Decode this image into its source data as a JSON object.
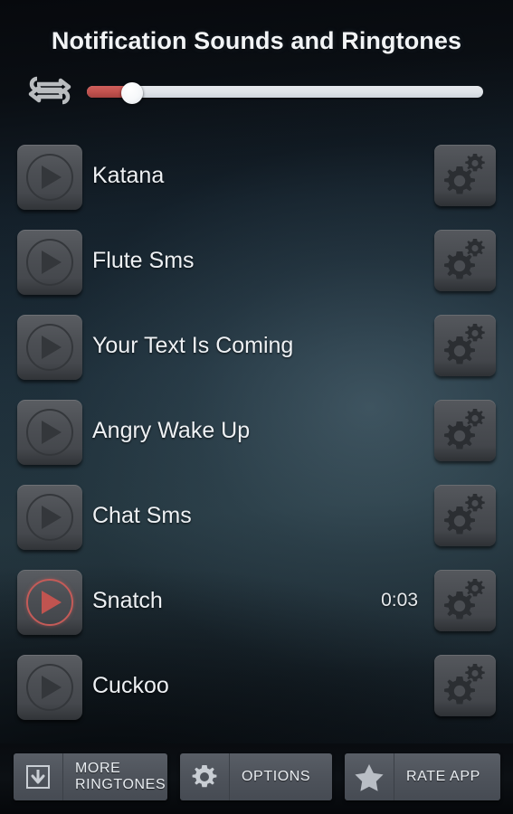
{
  "header": {
    "title": "Notification Sounds and Ringtones",
    "repeat_icon": "repeat-loop-icon",
    "slider": {
      "value_percent": 11,
      "fill_color": "#c0504d",
      "track_color": "#dfe3e8",
      "thumb_color": "#ffffff"
    }
  },
  "list": {
    "items": [
      {
        "name": "Katana",
        "play_icon": "play-icon",
        "gear_icon": "gears-icon",
        "duration": "",
        "playing": false
      },
      {
        "name": "Flute Sms",
        "play_icon": "play-icon",
        "gear_icon": "gears-icon",
        "duration": "",
        "playing": false
      },
      {
        "name": "Your Text Is Coming",
        "play_icon": "play-icon",
        "gear_icon": "gears-icon",
        "duration": "",
        "playing": false
      },
      {
        "name": "Angry Wake Up",
        "play_icon": "play-icon",
        "gear_icon": "gears-icon",
        "duration": "",
        "playing": false
      },
      {
        "name": "Chat Sms",
        "play_icon": "play-icon",
        "gear_icon": "gears-icon",
        "duration": "",
        "playing": false
      },
      {
        "name": "Snatch",
        "play_icon": "play-icon",
        "gear_icon": "gears-icon",
        "duration": "0:03",
        "playing": true
      },
      {
        "name": "Cuckoo",
        "play_icon": "play-icon",
        "gear_icon": "gears-icon",
        "duration": "",
        "playing": false
      }
    ]
  },
  "bottom_bar": {
    "more_ringtones": {
      "line1": "MORE",
      "line2": "RINGTONES",
      "icon": "download-box-icon"
    },
    "options": {
      "label": "OPTIONS",
      "icon": "gear-icon"
    },
    "rate_app": {
      "label": "RATE APP",
      "icon": "star-icon"
    }
  },
  "colors": {
    "background_top": "#07090d",
    "background_mid": "#24363f",
    "accent_red": "#c0504d",
    "button_gray": "#4e535b",
    "text_primary": "#eef1f4"
  }
}
